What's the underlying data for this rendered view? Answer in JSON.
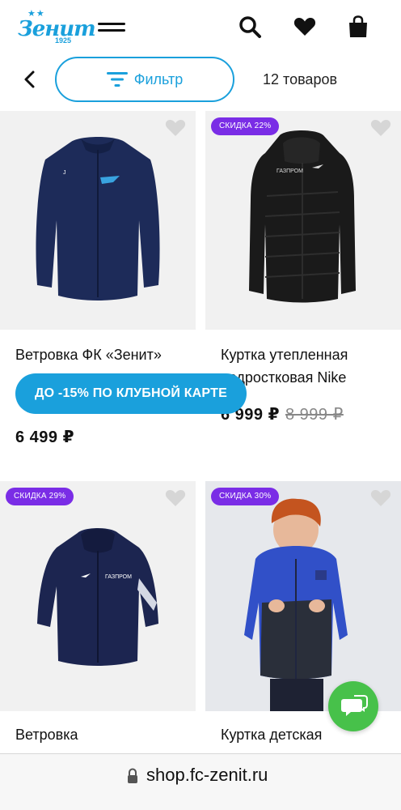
{
  "header": {
    "logo_text": "Зенит",
    "logo_year": "1925",
    "logo_stars": "★★"
  },
  "filter_row": {
    "filter_label": "Фильтр",
    "count_label": "12 товаров"
  },
  "promo": {
    "club_banner": "ДО -15% ПО КЛУБНОЙ КАРТЕ"
  },
  "products": [
    {
      "name": "Ветровка ФК «Зенит»",
      "price": "6 499 ₽",
      "old_price": "",
      "badge": ""
    },
    {
      "name": "Куртка утепленная подростковая Nike",
      "price": "6 999 ₽",
      "old_price": "8 999 ₽",
      "badge": "СКИДКА 22%"
    },
    {
      "name": "Ветровка",
      "price": "",
      "old_price": "",
      "badge": "СКИДКА 29%"
    },
    {
      "name": "Куртка детская",
      "price": "",
      "old_price": "",
      "badge": "СКИДКА 30%"
    }
  ],
  "browser": {
    "url": "shop.fc-zenit.ru"
  },
  "colors": {
    "brand_blue": "#1aa0dc",
    "badge_purple": "#7a2de6",
    "chat_green": "#47c14a",
    "card_bg": "#f1f1f1"
  },
  "icons": [
    "zenit-logo",
    "menu-icon",
    "search-icon",
    "heart-icon",
    "bag-icon",
    "back-arrow-icon",
    "filter-icon",
    "favorite-icon",
    "chat-icon",
    "lock-icon"
  ]
}
